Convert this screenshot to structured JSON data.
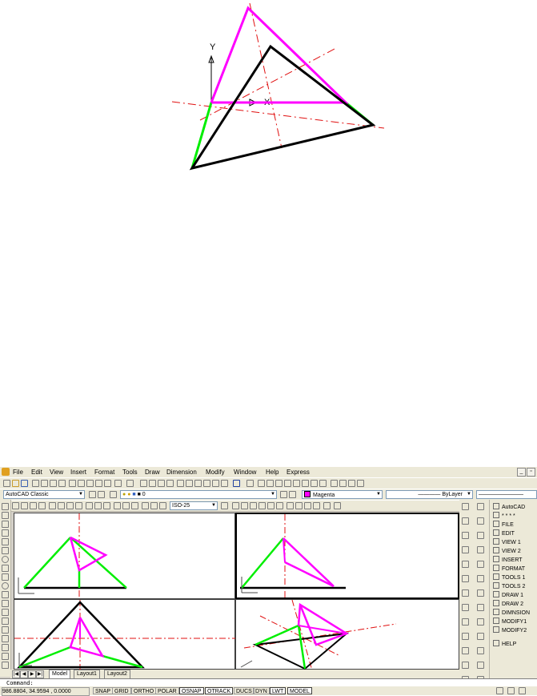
{
  "menu": {
    "items": [
      "File",
      "Edit",
      "View",
      "Insert",
      "Format",
      "Tools",
      "Draw",
      "Dimension",
      "Modify",
      "Window",
      "Help",
      "Express"
    ]
  },
  "toolbar": {
    "workspace": "AutoCAD Classic",
    "layer": "0",
    "color": "Magenta",
    "linetype": "ByLayer",
    "dimstyle": "ISO-25"
  },
  "top_figure": {
    "ucs_y": "Y",
    "ucs_x": "X"
  },
  "dashboard": {
    "items": [
      "AutoCAD",
      "* * * *",
      "FILE",
      "EDIT",
      "VIEW 1",
      "VIEW 2",
      "INSERT",
      "FORMAT",
      "TOOLS 1",
      "TOOLS 2",
      "DRAW 1",
      "DRAW 2",
      "DIMNSION",
      "MODIFY1",
      "MODIFY2",
      "HELP"
    ]
  },
  "tabs": [
    "Model",
    "Layout1",
    "Layout2"
  ],
  "command_prompt": "Command:",
  "status": {
    "coordinates": "986.8804, 34.9594 , 0.0000",
    "buttons": [
      {
        "label": "SNAP",
        "on": false
      },
      {
        "label": "GRID",
        "on": false
      },
      {
        "label": "ORTHO",
        "on": false
      },
      {
        "label": "POLAR",
        "on": false
      },
      {
        "label": "OSNAP",
        "on": true
      },
      {
        "label": "OTRACK",
        "on": true
      },
      {
        "label": "DUCS",
        "on": false
      },
      {
        "label": "DYN",
        "on": false
      },
      {
        "label": "LWT",
        "on": true
      },
      {
        "label": "MODEL",
        "on": true
      }
    ]
  },
  "colors": {
    "magenta": "#ff00ff",
    "green": "#00ee00",
    "black": "#000000",
    "center_line": "#e01010"
  }
}
